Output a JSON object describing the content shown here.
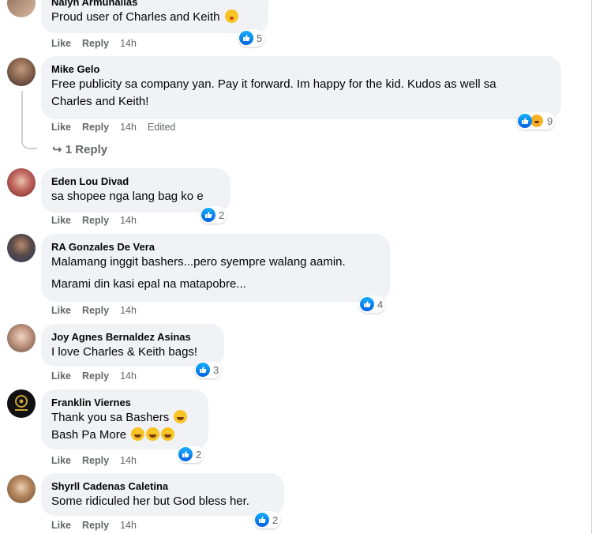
{
  "comments": [
    {
      "author": "Nalyn Armunallas",
      "lines": [
        "Proud user of Charles and Keith"
      ],
      "like": "Like",
      "reply": "Reply",
      "time": "14h",
      "reactions": "5"
    },
    {
      "author": "Mike Gelo",
      "lines": [
        "Free publicity sa company yan. Pay it forward. Im happy for the kid. Kudos as well sa",
        "Charles and Keith!"
      ],
      "like": "Like",
      "reply": "Reply",
      "time": "14h",
      "edited": "Edited",
      "reactions": "9",
      "replies": "1 Reply"
    },
    {
      "author": "Eden Lou Divad",
      "lines": [
        "sa shopee nga lang bag ko e"
      ],
      "like": "Like",
      "reply": "Reply",
      "time": "14h",
      "reactions": "2"
    },
    {
      "author": "RA Gonzales De Vera",
      "lines": [
        "Malamang inggit bashers...pero syempre walang aamin.",
        "Marami din kasi epal na matapobre..."
      ],
      "like": "Like",
      "reply": "Reply",
      "time": "14h",
      "reactions": "4"
    },
    {
      "author": "Joy Agnes Bernaldez Asinas",
      "lines": [
        "I love Charles & Keith bags!"
      ],
      "like": "Like",
      "reply": "Reply",
      "time": "14h",
      "reactions": "3"
    },
    {
      "author": "Franklin Viernes",
      "lines": [
        "Thank you sa Bashers",
        "Bash Pa More"
      ],
      "like": "Like",
      "reply": "Reply",
      "time": "14h",
      "reactions": "2"
    },
    {
      "author": "Shyrll Cadenas Caletina",
      "lines": [
        "Some ridiculed her but God bless her."
      ],
      "like": "Like",
      "reply": "Reply",
      "time": "14h",
      "reactions": "2"
    }
  ],
  "colors": {
    "like_blue": "#1877f2",
    "bubble": "#f0f2f5",
    "meta_gray": "#65676b"
  },
  "icons": {
    "like": "thumbs-up-icon",
    "haha": "laughing-face-icon",
    "reply_arrow": "reply-arrow-icon"
  }
}
